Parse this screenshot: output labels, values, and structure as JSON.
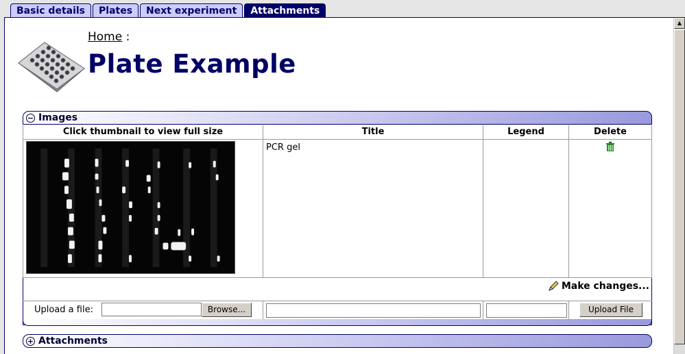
{
  "tabs": [
    {
      "label": "Basic details",
      "active": false
    },
    {
      "label": "Plates",
      "active": false
    },
    {
      "label": "Next experiment",
      "active": false
    },
    {
      "label": "Attachments",
      "active": true
    }
  ],
  "breadcrumb": {
    "home_label": "Home",
    "separator": ":"
  },
  "page_title": "Plate Example",
  "images_panel": {
    "title": "Images",
    "toggle_symbol": "⊖",
    "columns": [
      "Click thumbnail to view full size",
      "Title",
      "Legend",
      "Delete"
    ],
    "rows": [
      {
        "title": "PCR gel",
        "legend": "",
        "delete_icon": "trash-icon"
      }
    ],
    "make_changes_label": "Make changes...",
    "upload": {
      "label": "Upload a file:",
      "browse_label": "Browse...",
      "upload_button_label": "Upload File",
      "file_value": "",
      "title_value": "",
      "legend_value": ""
    }
  },
  "attachments_panel": {
    "title": "Attachments",
    "toggle_symbol": "⊕"
  },
  "colors": {
    "tab_active": "#000066",
    "tab_inactive": "#ccccff",
    "title": "#000066",
    "delete_icon": "#2a8a2a"
  }
}
